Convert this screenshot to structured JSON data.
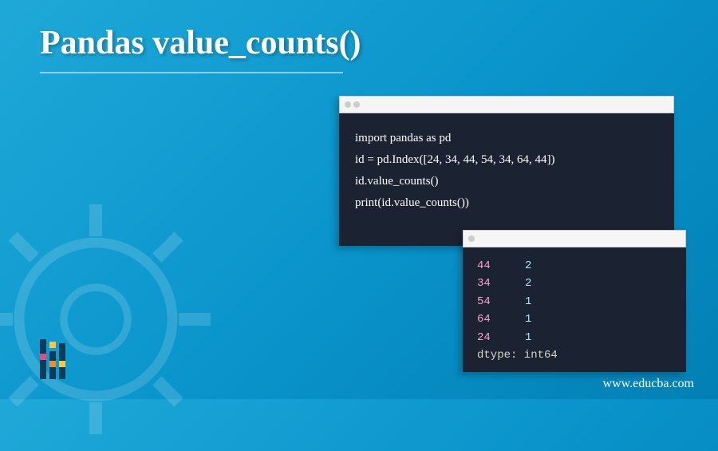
{
  "title": "Pandas value_counts()",
  "code": {
    "line1": "import pandas as pd",
    "line2": "id = pd.Index([24, 34, 44, 54, 34, 64, 44])",
    "line3": "id.value_counts()",
    "line4": "print(id.value_counts())"
  },
  "output": {
    "rows": [
      {
        "key": "44",
        "val": "2"
      },
      {
        "key": "34",
        "val": "2"
      },
      {
        "key": "54",
        "val": "1"
      },
      {
        "key": "64",
        "val": "1"
      },
      {
        "key": "24",
        "val": "1"
      }
    ],
    "dtype": "dtype: int64"
  },
  "website": "www.educba.com"
}
